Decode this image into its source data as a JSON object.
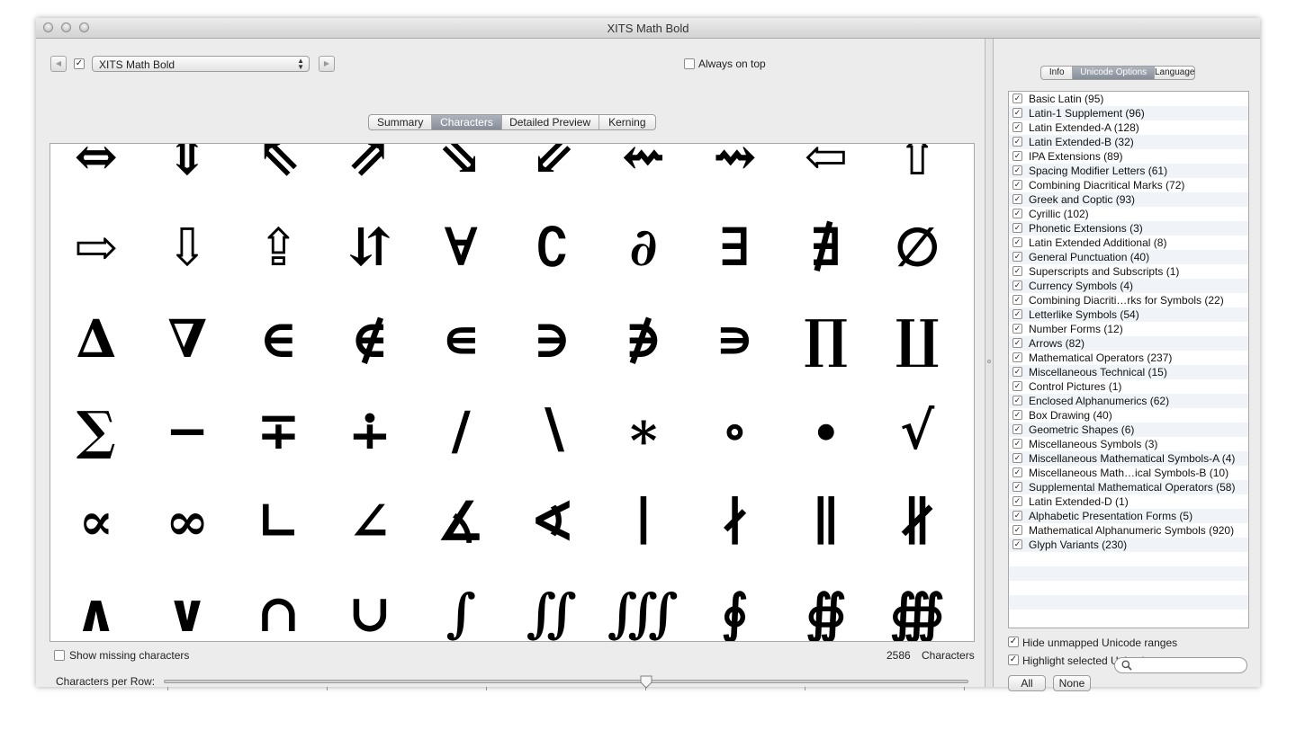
{
  "window": {
    "title": "XITS Math Bold"
  },
  "toolbar": {
    "back_icon": "left-triangle-icon",
    "forward_icon": "right-triangle-icon",
    "font_enabled": true,
    "font_popup_value": "XITS Math Bold",
    "always_on_top_label": "Always on top",
    "always_on_top_checked": false
  },
  "tabs": [
    {
      "label": "Summary",
      "active": false
    },
    {
      "label": "Characters",
      "active": true
    },
    {
      "label": "Detailed Preview",
      "active": false
    },
    {
      "label": "Kerning",
      "active": false
    }
  ],
  "glyphs": [
    "⇔",
    "⇕",
    "⇖",
    "⇗",
    "⇘",
    "⇙",
    "⇜",
    "⇝",
    "⇦",
    "⇧",
    "⇨",
    "⇩",
    "⇪",
    "⇵",
    "∀",
    "∁",
    "∂",
    "∃",
    "∄",
    "∅",
    "∆",
    "∇",
    "∈",
    "∉",
    "∊",
    "∋",
    "∌",
    "∍",
    "∏",
    "∐",
    "∑",
    "−",
    "∓",
    "∔",
    "∕",
    "∖",
    "∗",
    "∘",
    "∙",
    "√",
    "∝",
    "∞",
    "∟",
    "∠",
    "∡",
    "∢",
    "∣",
    "∤",
    "∥",
    "∦",
    "∧",
    "∨",
    "∩",
    "∪",
    "∫",
    "∬",
    "∭",
    "∮",
    "∯",
    "∰"
  ],
  "characters_panel": {
    "show_missing_label": "Show missing characters",
    "show_missing_checked": false,
    "count_value": "2586",
    "count_unit": "Characters",
    "per_row_label": "Characters per Row:",
    "per_row_slider_position": 0.6
  },
  "right_tabs": [
    {
      "label": "Info",
      "active": false
    },
    {
      "label": "Unicode Options",
      "active": true
    },
    {
      "label": "Languages",
      "active": false
    }
  ],
  "unicode_ranges": [
    "Basic Latin (95)",
    "Latin-1 Supplement (96)",
    "Latin Extended-A (128)",
    "Latin Extended-B (32)",
    "IPA Extensions (89)",
    "Spacing Modifier Letters (61)",
    "Combining Diacritical Marks (72)",
    "Greek and Coptic (93)",
    "Cyrillic (102)",
    "Phonetic Extensions (3)",
    "Latin Extended Additional (8)",
    "General Punctuation (40)",
    "Superscripts and Subscripts (1)",
    "Currency Symbols (4)",
    "Combining Diacriti…rks for Symbols (22)",
    "Letterlike Symbols (54)",
    "Number Forms (12)",
    "Arrows (82)",
    "Mathematical Operators (237)",
    "Miscellaneous Technical (15)",
    "Control Pictures (1)",
    "Enclosed Alphanumerics (62)",
    "Box Drawing (40)",
    "Geometric Shapes (6)",
    "Miscellaneous Symbols (3)",
    "Miscellaneous Mathematical Symbols-A (4)",
    "Miscellaneous Math…ical Symbols-B (10)",
    "Supplemental Mathematical Operators (58)",
    "Latin Extended-D (1)",
    "Alphabetic Presentation Forms (5)",
    "Mathematical Alphanumeric Symbols (920)",
    "Glyph Variants (230)"
  ],
  "options": {
    "hide_unmapped_label": "Hide unmapped Unicode ranges",
    "hide_unmapped_checked": true,
    "highlight_selected_label": "Highlight selected Unicode range",
    "highlight_selected_checked": true,
    "all_button": "All",
    "none_button": "None",
    "search_placeholder": "",
    "search_icon": "magnifier-icon"
  }
}
